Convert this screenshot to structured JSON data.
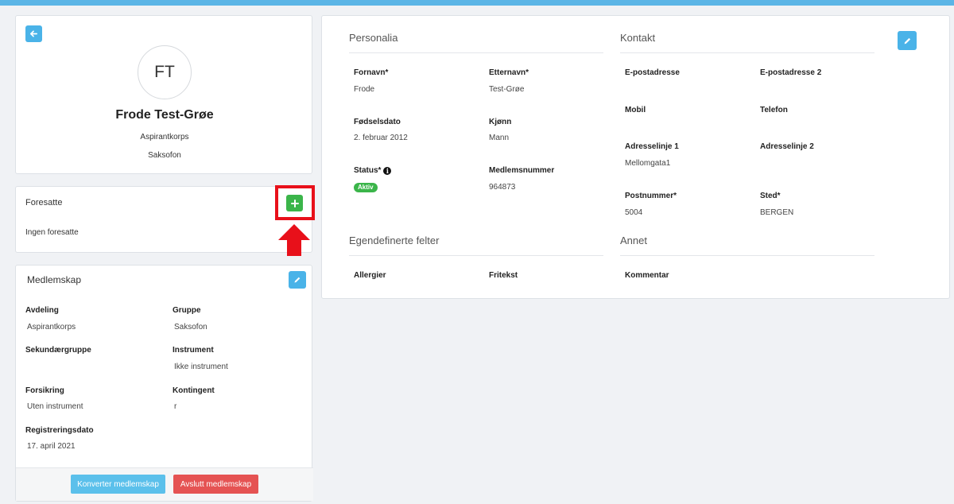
{
  "profile": {
    "initials": "FT",
    "name": "Frode Test-Grøe",
    "department": "Aspirantkorps",
    "instrument": "Saksofon"
  },
  "guardians": {
    "title": "Foresatte",
    "empty_text": "Ingen foresatte"
  },
  "membership": {
    "title": "Medlemskap",
    "fields": [
      {
        "label": "Avdeling",
        "value": "Aspirantkorps"
      },
      {
        "label": "Gruppe",
        "value": "Saksofon"
      },
      {
        "label": "Sekundærgruppe",
        "value": ""
      },
      {
        "label": "Instrument",
        "value": "Ikke instrument"
      },
      {
        "label": "Forsikring",
        "value": "Uten instrument"
      },
      {
        "label": "Kontingent",
        "value": "r"
      },
      {
        "label": "Registreringsdato",
        "value": "17. april 2021"
      }
    ],
    "convert_label": "Konverter medlemskap",
    "end_label": "Avslutt medlemskap"
  },
  "personalia": {
    "title": "Personalia",
    "fields": [
      {
        "label": "Fornavn*",
        "value": "Frode"
      },
      {
        "label": "Etternavn*",
        "value": "Test-Grøe"
      },
      {
        "label": "Fødselsdato",
        "value": "2. februar 2012"
      },
      {
        "label": "Kjønn",
        "value": "Mann"
      },
      {
        "label": "Status*",
        "value": "Aktiv"
      },
      {
        "label": "Medlemsnummer",
        "value": "964873"
      }
    ]
  },
  "contact": {
    "title": "Kontakt",
    "fields": [
      {
        "label": "E-postadresse",
        "value": ""
      },
      {
        "label": "E-postadresse 2",
        "value": ""
      },
      {
        "label": "Mobil",
        "value": ""
      },
      {
        "label": "Telefon",
        "value": ""
      },
      {
        "label": "Adresselinje 1",
        "value": "Mellomgata1"
      },
      {
        "label": "Adresselinje 2",
        "value": ""
      },
      {
        "label": "Postnummer*",
        "value": "5004"
      },
      {
        "label": "Sted*",
        "value": "BERGEN"
      }
    ]
  },
  "custom_fields": {
    "title": "Egendefinerte felter",
    "fields": [
      {
        "label": "Allergier",
        "value": ""
      },
      {
        "label": "Fritekst",
        "value": ""
      }
    ]
  },
  "other": {
    "title": "Annet",
    "fields": [
      {
        "label": "Kommentar",
        "value": ""
      }
    ]
  },
  "colors": {
    "accent_blue": "#4ab3e8",
    "add_green": "#3bb54a",
    "danger_red": "#e55353",
    "highlight_red": "#e8101a"
  },
  "icons": {
    "back": "arrow-left-icon",
    "edit": "pencil-icon",
    "add": "plus-icon",
    "info": "info-circle-icon"
  }
}
